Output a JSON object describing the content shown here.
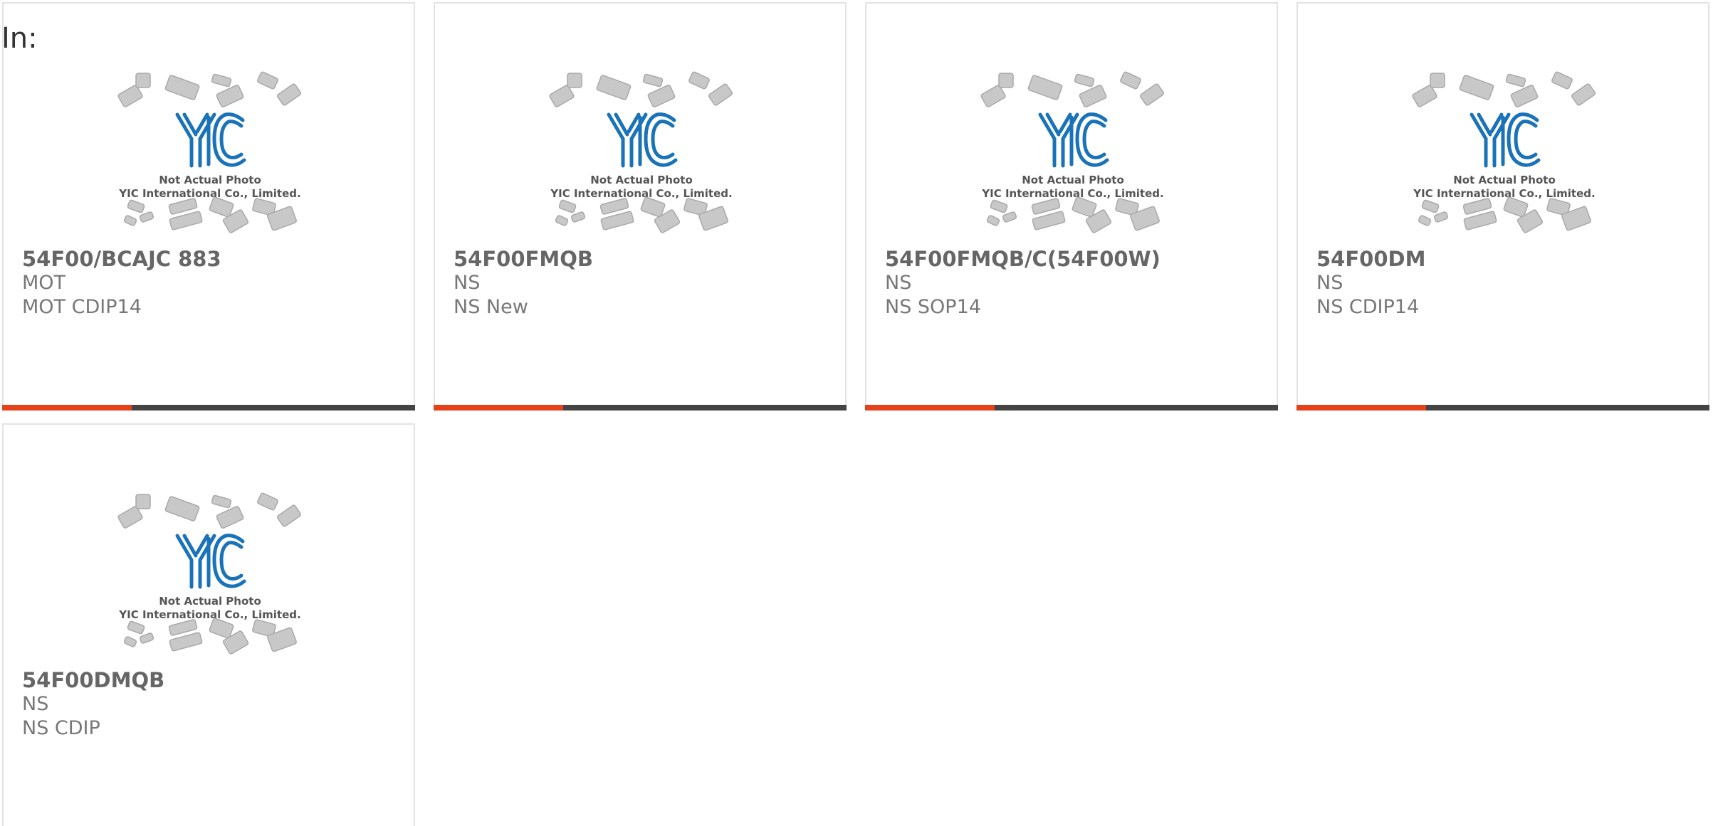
{
  "header": {
    "label": "In:"
  },
  "placeholder_image": {
    "logo_text": "YIC",
    "caption_line1": "Not Actual Photo",
    "caption_line2": "YIC International Co., Limited."
  },
  "colors": {
    "accent": "#e5411b",
    "bar_dark": "#444444",
    "logo_blue": "#1a73b8",
    "text_gray": "#666666"
  },
  "products": [
    {
      "part": "54F00/BCAJC 883",
      "maker": "MOT",
      "package": "MOT CDIP14"
    },
    {
      "part": "54F00FMQB",
      "maker": "NS",
      "package": "NS New"
    },
    {
      "part": "54F00FMQB/C(54F00W)",
      "maker": "NS",
      "package": "NS SOP14"
    },
    {
      "part": "54F00DM",
      "maker": "NS",
      "package": "NS CDIP14"
    },
    {
      "part": "54F00DMQB",
      "maker": "NS",
      "package": "NS CDIP"
    }
  ]
}
